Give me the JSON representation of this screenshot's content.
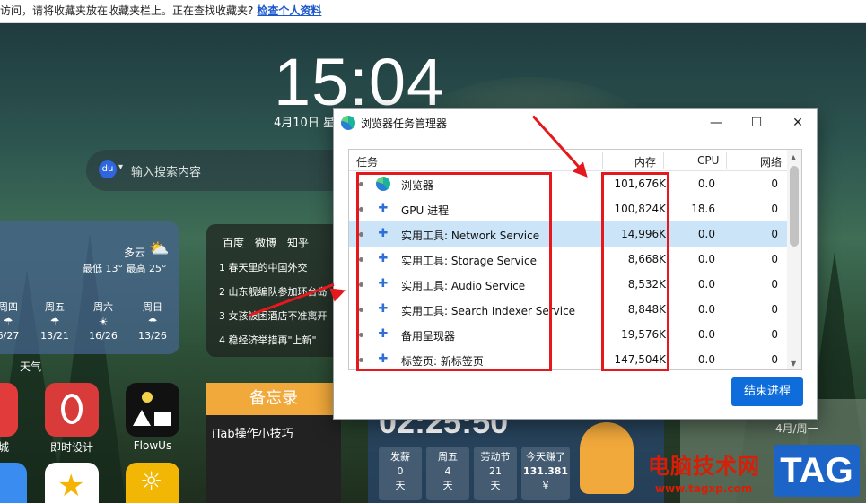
{
  "notification": {
    "text": "访问，请将收藏夹放在收藏夹栏上。正在查找收藏夹?",
    "link": "检查个人资料"
  },
  "clock": {
    "time": "15:04",
    "date": "4月10日 星"
  },
  "search": {
    "placeholder": "输入搜索内容"
  },
  "weather": {
    "condition": "多云",
    "range": "最低 13° 最高 25°",
    "days": [
      {
        "name": "周四",
        "temp": "6/27"
      },
      {
        "name": "周五",
        "temp": "13/21"
      },
      {
        "name": "周六",
        "temp": "16/26"
      },
      {
        "name": "周日",
        "temp": "13/26"
      }
    ],
    "label": "天气"
  },
  "hot": {
    "tabs": [
      "百度",
      "微博",
      "知乎"
    ],
    "items": [
      "1 春天里的中国外交",
      "2 山东舰编队参加环台岛",
      "3 女孩被困酒店不准离开",
      "4 稳经济举措再\"上新\""
    ]
  },
  "apps": {
    "items": [
      "城",
      "即时设计",
      "FlowUs"
    ]
  },
  "memo": {
    "title": "备忘录",
    "line": "iTab操作小技巧"
  },
  "countdown": {
    "time": "02:25:50",
    "cards": [
      {
        "label": "发薪",
        "num": "0",
        "unit": "天"
      },
      {
        "label": "周五",
        "num": "4",
        "unit": "天"
      },
      {
        "label": "劳动节",
        "num": "21",
        "unit": "天"
      },
      {
        "label": "今天赚了",
        "num": "131.381",
        "unit": "¥"
      }
    ]
  },
  "right_widget": {
    "date": "4月/周一"
  },
  "watermark": {
    "title": "电脑技术网",
    "url": "www.tagxp.com",
    "tag": "TAG"
  },
  "task_manager": {
    "title": "浏览器任务管理器",
    "controls": {
      "minimize": "—",
      "maximize": "☐",
      "close": "✕"
    },
    "columns": {
      "task": "任务",
      "memory": "内存",
      "cpu": "CPU",
      "network": "网络"
    },
    "rows": [
      {
        "name": "浏览器",
        "memory": "101,676K",
        "cpu": "0.0",
        "network": "0",
        "icon": "edge-icon"
      },
      {
        "name": "GPU 进程",
        "memory": "100,824K",
        "cpu": "18.6",
        "network": "0",
        "icon": "puzzle-icon"
      },
      {
        "name": "实用工具: Network Service",
        "memory": "14,996K",
        "cpu": "0.0",
        "network": "0",
        "icon": "puzzle-icon",
        "selected": true
      },
      {
        "name": "实用工具: Storage Service",
        "memory": "8,668K",
        "cpu": "0.0",
        "network": "0",
        "icon": "puzzle-icon"
      },
      {
        "name": "实用工具: Audio Service",
        "memory": "8,532K",
        "cpu": "0.0",
        "network": "0",
        "icon": "puzzle-icon"
      },
      {
        "name": "实用工具: Search Indexer Service",
        "memory": "8,848K",
        "cpu": "0.0",
        "network": "0",
        "icon": "puzzle-icon"
      },
      {
        "name": "备用呈现器",
        "memory": "19,576K",
        "cpu": "0.0",
        "network": "0",
        "icon": "puzzle-icon"
      },
      {
        "name": "标签页: 新标签页",
        "memory": "147,504K",
        "cpu": "0.0",
        "network": "0",
        "icon": "puzzle-icon"
      }
    ],
    "end_button": "结束进程"
  }
}
